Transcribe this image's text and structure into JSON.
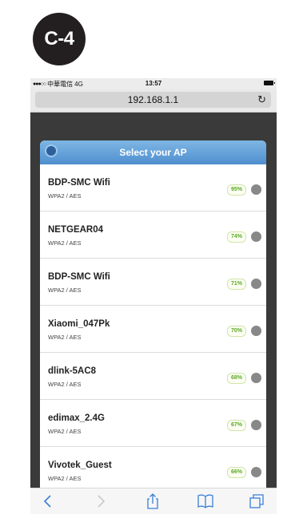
{
  "badge": {
    "label": "C-4"
  },
  "status_bar": {
    "signal": "●●●○○",
    "carrier": "中華電信",
    "network": "4G",
    "time": "13:57"
  },
  "browser": {
    "url": "192.168.1.1",
    "reload_icon": "reload-icon"
  },
  "dialog": {
    "title": "Select your AP",
    "back_icon": "circle-back-icon"
  },
  "access_points": [
    {
      "name": "BDP-SMC Wifi",
      "security": "WPA2 / AES",
      "signal": "95%"
    },
    {
      "name": "NETGEAR04",
      "security": "WPA2 / AES",
      "signal": "74%"
    },
    {
      "name": "BDP-SMC Wifi",
      "security": "WPA2 / AES",
      "signal": "71%"
    },
    {
      "name": "Xiaomi_047Pk",
      "security": "WPA2 / AES",
      "signal": "70%"
    },
    {
      "name": "dlink-5AC8",
      "security": "WPA2 / AES",
      "signal": "68%"
    },
    {
      "name": "edimax_2.4G",
      "security": "WPA2 / AES",
      "signal": "67%"
    },
    {
      "name": "Vivotek_Guest",
      "security": "WPA2 / AES",
      "signal": "66%"
    }
  ],
  "toolbar": {
    "icons": [
      "back-icon",
      "forward-icon",
      "share-icon",
      "bookmarks-icon",
      "tabs-icon"
    ]
  },
  "colors": {
    "header_blue": "#4f8fcf",
    "signal_green": "#5aaa23",
    "ios_blue": "#3a7fd8",
    "badge_dark": "#231f20"
  }
}
